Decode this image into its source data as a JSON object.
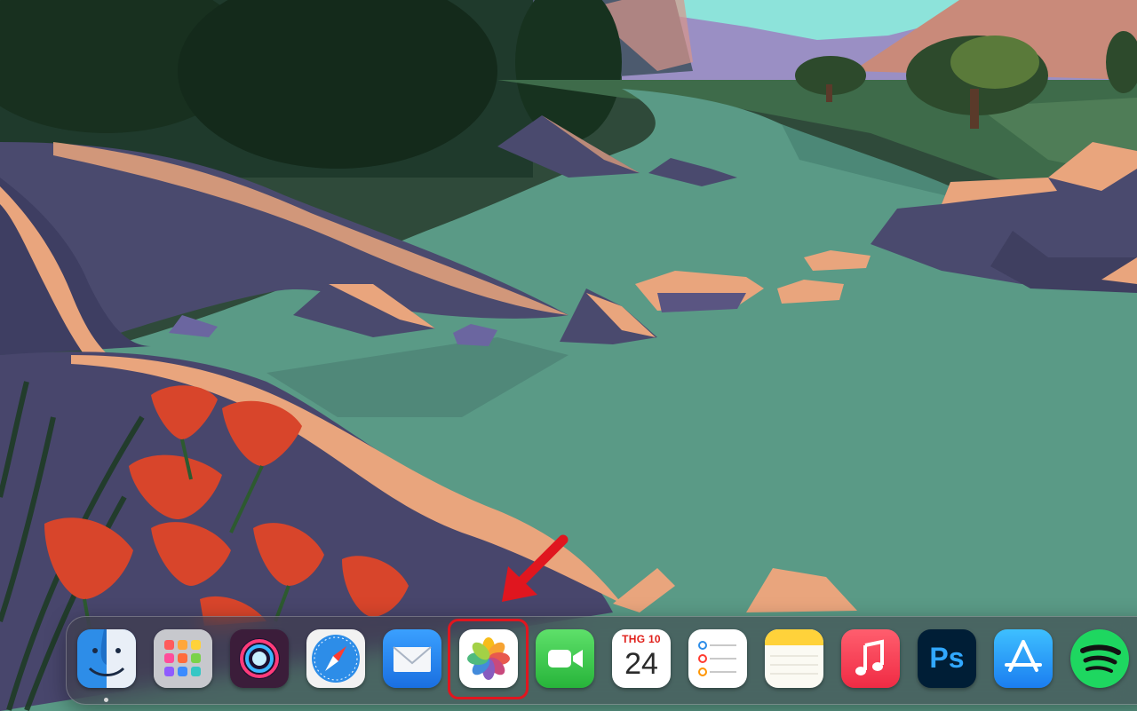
{
  "dock": {
    "items": [
      {
        "id": "finder",
        "icon": "finder-icon",
        "running": true
      },
      {
        "id": "launchpad",
        "icon": "launchpad-icon"
      },
      {
        "id": "siri",
        "icon": "siri-icon"
      },
      {
        "id": "safari",
        "icon": "safari-icon"
      },
      {
        "id": "mail",
        "icon": "mail-icon"
      },
      {
        "id": "photos",
        "icon": "photos-icon",
        "highlighted": true
      },
      {
        "id": "facetime",
        "icon": "facetime-icon"
      },
      {
        "id": "calendar",
        "icon": "calendar-icon",
        "month": "THG 10",
        "day": "24"
      },
      {
        "id": "reminders",
        "icon": "reminders-icon"
      },
      {
        "id": "notes",
        "icon": "notes-icon"
      },
      {
        "id": "music",
        "icon": "music-icon"
      },
      {
        "id": "photoshop",
        "icon": "photoshop-icon",
        "label": "Ps"
      },
      {
        "id": "app-store",
        "icon": "app-store-icon"
      },
      {
        "id": "spotify",
        "icon": "spotify-icon"
      }
    ]
  },
  "annotation": {
    "color": "#e0161f",
    "target": "photos"
  },
  "colors": {
    "water": "#5a9a86",
    "sky": "#8de3da",
    "rock": "#4a4a6e",
    "sand": "#e9a57d",
    "poppy": "#d8452b"
  }
}
